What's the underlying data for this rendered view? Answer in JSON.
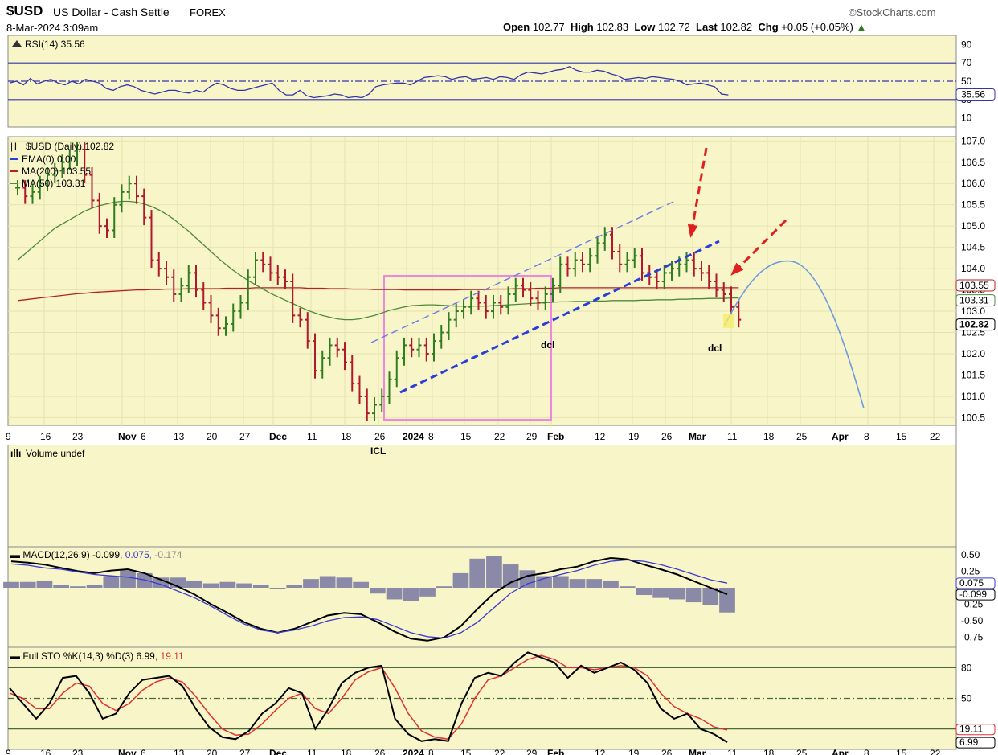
{
  "header": {
    "symbol": "$USD",
    "name": "US Dollar - Cash Settle",
    "exchange": "FOREX",
    "source": "©StockCharts.com",
    "datetime": "8-Mar-2024 3:09am",
    "open_label": "Open",
    "open": "102.77",
    "high_label": "High",
    "high": "102.83",
    "low_label": "Low",
    "low": "102.72",
    "last_label": "Last",
    "last": "102.82",
    "chg_label": "Chg",
    "chg": "+0.05 (+0.05%)"
  },
  "colors": {
    "panel_bg": "#f8f6c8",
    "price_up": "#2e7d1e",
    "price_down": "#b0182c",
    "ma200": "#b22222",
    "ma50": "#4f8a3a",
    "channel": "#2b3fd8",
    "box": "#ee88dd",
    "forecast": "#6b9be0",
    "arrow": "#e02020",
    "rsi": "#3434a8",
    "macd": "#000000",
    "signal": "#3a3ad0",
    "hist": "#8a8aa8",
    "k_line": "#000000",
    "d_line": "#e03030"
  },
  "chart_data": [
    {
      "type": "line",
      "panel": "rsi",
      "title": "RSI(14) 35.56",
      "ylim": [
        0,
        100
      ],
      "ticks": [
        "90",
        "70",
        "50",
        "30",
        "10"
      ],
      "tick_values": [
        90,
        70,
        50,
        30,
        10
      ],
      "reference_lines": [
        70,
        50,
        30
      ],
      "last_label": "35.56",
      "series": [
        {
          "name": "RSI(14)",
          "values": [
            48,
            50,
            46,
            53,
            47,
            50,
            52,
            48,
            46,
            50,
            47,
            52,
            50,
            48,
            42,
            40,
            44,
            46,
            44,
            40,
            38,
            36,
            38,
            40,
            40,
            38,
            37,
            40,
            38,
            44,
            48,
            46,
            42,
            40,
            40,
            42,
            44,
            46,
            48,
            40,
            35,
            35,
            40,
            34,
            32,
            33,
            34,
            36,
            35,
            32,
            33,
            32,
            36,
            44,
            46,
            47,
            48,
            48,
            46,
            50,
            54,
            55,
            56,
            55,
            52,
            54,
            55,
            52,
            53,
            54,
            52,
            55,
            54,
            52,
            57,
            60,
            59,
            58,
            60,
            62,
            63,
            66,
            62,
            60,
            60,
            62,
            61,
            58,
            56,
            52,
            53,
            54,
            53,
            55,
            54,
            53,
            52,
            50,
            46,
            47,
            48,
            46,
            44,
            36,
            35
          ]
        }
      ]
    },
    {
      "type": "bar",
      "panel": "price",
      "title": "$USD (Daily) 102.82",
      "ylim": [
        100.3,
        107.1
      ],
      "ticks": [
        "107.0",
        "106.5",
        "106.0",
        "105.5",
        "105.0",
        "104.5",
        "104.0",
        "103.5",
        "103.0",
        "102.5",
        "102.0",
        "101.5",
        "101.0",
        "100.5"
      ],
      "tick_values": [
        107.0,
        106.5,
        106.0,
        105.5,
        105.0,
        104.5,
        104.0,
        103.5,
        103.0,
        102.5,
        102.0,
        101.5,
        101.0,
        100.5
      ],
      "legend": [
        "EMA(0) 0.00",
        "MA(200) 103.55",
        "MA(50) 103.31"
      ],
      "right_labels": [
        "103.55",
        "103.31",
        "102.82"
      ],
      "x_labels": [
        "9",
        "16",
        "23",
        "Nov",
        "6",
        "13",
        "20",
        "27",
        "Dec",
        "11",
        "18",
        "26",
        "2024",
        "8",
        "15",
        "22",
        "29",
        "Feb",
        "12",
        "19",
        "26",
        "Mar",
        "11",
        "18",
        "25",
        "Apr",
        "8",
        "15",
        "22"
      ],
      "annotations": [
        "ICL",
        "dcl",
        "dcl"
      ],
      "ohlc_close": [
        105.9,
        105.7,
        105.8,
        106.0,
        106.2,
        106.3,
        106.5,
        106.6,
        106.8,
        106.2,
        105.6,
        105.0,
        104.9,
        105.5,
        105.8,
        106.0,
        105.7,
        105.2,
        104.2,
        104.0,
        103.8,
        103.4,
        103.6,
        103.9,
        103.5,
        103.2,
        102.9,
        102.6,
        102.7,
        103.0,
        103.2,
        103.8,
        104.2,
        104.1,
        103.9,
        103.8,
        103.7,
        102.9,
        102.8,
        102.3,
        101.6,
        101.9,
        102.2,
        102.1,
        101.8,
        101.3,
        101.0,
        100.6,
        100.8,
        101.0,
        101.4,
        101.9,
        102.2,
        102.1,
        102.2,
        102.0,
        102.3,
        102.5,
        102.8,
        103.0,
        103.1,
        103.3,
        103.2,
        103.0,
        103.2,
        103.1,
        103.4,
        103.6,
        103.5,
        103.3,
        103.2,
        103.4,
        103.6,
        104.1,
        104.0,
        104.2,
        104.1,
        104.3,
        104.6,
        104.8,
        104.4,
        104.1,
        104.2,
        104.3,
        103.9,
        103.8,
        103.7,
        103.9,
        104.0,
        104.1,
        104.2,
        104.0,
        103.9,
        103.7,
        103.5,
        103.4,
        103.1,
        102.8
      ],
      "ma200": [
        103.25,
        103.27,
        103.29,
        103.31,
        103.33,
        103.35,
        103.37,
        103.39,
        103.41,
        103.42,
        103.44,
        103.45,
        103.46,
        103.47,
        103.48,
        103.49,
        103.5,
        103.5,
        103.51,
        103.51,
        103.52,
        103.52,
        103.52,
        103.53,
        103.53,
        103.53,
        103.53,
        103.53,
        103.54,
        103.54,
        103.54,
        103.54,
        103.55,
        103.55,
        103.55,
        103.55,
        103.55,
        103.55,
        103.55,
        103.54,
        103.54,
        103.54,
        103.53,
        103.53,
        103.53,
        103.52,
        103.52,
        103.52,
        103.51,
        103.51,
        103.51,
        103.51,
        103.5,
        103.5,
        103.5,
        103.5,
        103.5,
        103.5,
        103.5,
        103.5,
        103.51,
        103.51,
        103.51,
        103.51,
        103.52,
        103.52,
        103.52,
        103.53,
        103.53,
        103.53,
        103.54,
        103.54,
        103.54,
        103.55,
        103.55,
        103.55,
        103.55,
        103.55,
        103.55,
        103.55,
        103.55,
        103.55,
        103.55,
        103.55,
        103.55,
        103.55,
        103.55,
        103.55,
        103.55,
        103.55,
        103.55,
        103.55,
        103.55,
        103.55,
        103.55,
        103.55,
        103.55,
        103.55
      ],
      "ma50": [
        104.2,
        104.35,
        104.5,
        104.65,
        104.8,
        104.95,
        105.05,
        105.15,
        105.25,
        105.35,
        105.42,
        105.48,
        105.52,
        105.56,
        105.58,
        105.58,
        105.56,
        105.52,
        105.46,
        105.38,
        105.28,
        105.16,
        105.02,
        104.88,
        104.72,
        104.56,
        104.4,
        104.24,
        104.1,
        103.96,
        103.84,
        103.72,
        103.62,
        103.52,
        103.42,
        103.34,
        103.26,
        103.18,
        103.1,
        103.02,
        102.96,
        102.9,
        102.86,
        102.82,
        102.8,
        102.8,
        102.82,
        102.86,
        102.9,
        102.96,
        103.02,
        103.06,
        103.1,
        103.13,
        103.14,
        103.15,
        103.15,
        103.14,
        103.13,
        103.12,
        103.12,
        103.12,
        103.12,
        103.12,
        103.13,
        103.14,
        103.15,
        103.16,
        103.17,
        103.18,
        103.19,
        103.2,
        103.21,
        103.22,
        103.22,
        103.23,
        103.23,
        103.23,
        103.24,
        103.24,
        103.25,
        103.25,
        103.25,
        103.25,
        103.26,
        103.26,
        103.27,
        103.27,
        103.27,
        103.28,
        103.28,
        103.29,
        103.29,
        103.3,
        103.3,
        103.3,
        103.31,
        103.31
      ]
    },
    {
      "type": "bar",
      "panel": "volume",
      "title": "Volume undef"
    },
    {
      "type": "line",
      "panel": "macd",
      "title": "MACD(12,26,9)",
      "title_values": [
        "-0.099",
        "0.075",
        "-0.174"
      ],
      "ticks": [
        "0.50",
        "0.25",
        "0.00",
        "-0.25",
        "-0.50",
        "-0.75"
      ],
      "tick_values": [
        0.5,
        0.25,
        0.0,
        -0.25,
        -0.5,
        -0.75
      ],
      "ylim": [
        -0.9,
        0.62
      ],
      "right_labels": [
        "0.075",
        "-0.099"
      ],
      "series": [
        {
          "name": "MACD",
          "values": [
            0.4,
            0.38,
            0.35,
            0.3,
            0.25,
            0.22,
            0.26,
            0.28,
            0.22,
            0.12,
            0.02,
            -0.1,
            -0.25,
            -0.38,
            -0.52,
            -0.62,
            -0.68,
            -0.62,
            -0.52,
            -0.42,
            -0.38,
            -0.4,
            -0.52,
            -0.66,
            -0.77,
            -0.8,
            -0.75,
            -0.58,
            -0.32,
            -0.08,
            0.08,
            0.18,
            0.22,
            0.28,
            0.32,
            0.4,
            0.45,
            0.43,
            0.35,
            0.28,
            0.2,
            0.1,
            0.0,
            -0.1
          ]
        },
        {
          "name": "Signal",
          "values": [
            0.36,
            0.34,
            0.3,
            0.28,
            0.24,
            0.2,
            0.18,
            0.16,
            0.12,
            0.05,
            -0.05,
            -0.15,
            -0.28,
            -0.42,
            -0.55,
            -0.64,
            -0.68,
            -0.64,
            -0.58,
            -0.5,
            -0.45,
            -0.44,
            -0.48,
            -0.58,
            -0.68,
            -0.74,
            -0.76,
            -0.68,
            -0.52,
            -0.3,
            -0.08,
            0.06,
            0.14,
            0.2,
            0.26,
            0.34,
            0.4,
            0.42,
            0.4,
            0.35,
            0.28,
            0.2,
            0.12,
            0.07
          ]
        },
        {
          "name": "Histogram",
          "values": [
            0.04,
            0.04,
            0.05,
            0.02,
            0.01,
            0.02,
            0.08,
            0.12,
            0.1,
            0.07,
            0.07,
            0.05,
            0.03,
            0.04,
            0.03,
            0.02,
            0.0,
            0.02,
            0.06,
            0.08,
            0.07,
            0.04,
            -0.04,
            -0.08,
            -0.09,
            -0.06,
            0.01,
            0.1,
            0.2,
            0.22,
            0.16,
            0.12,
            0.08,
            0.08,
            0.06,
            0.06,
            0.05,
            0.01,
            -0.05,
            -0.07,
            -0.08,
            -0.1,
            -0.12,
            -0.17
          ]
        }
      ]
    },
    {
      "type": "line",
      "panel": "stochastic",
      "title": "Full STO %K(14,3) %D(3)",
      "title_values": [
        "6.99",
        "19.11"
      ],
      "ticks": [
        "80",
        "50"
      ],
      "tick_values": [
        80,
        50
      ],
      "reference_lines": [
        80,
        50,
        20
      ],
      "ylim": [
        0,
        100
      ],
      "right_labels": [
        "19.11",
        "6.99"
      ],
      "series": [
        {
          "name": "%K",
          "values": [
            60,
            45,
            30,
            45,
            70,
            72,
            55,
            30,
            35,
            55,
            68,
            70,
            72,
            62,
            40,
            22,
            12,
            10,
            18,
            35,
            45,
            60,
            55,
            20,
            40,
            65,
            75,
            80,
            82,
            30,
            15,
            8,
            10,
            8,
            45,
            70,
            75,
            72,
            85,
            95,
            90,
            85,
            70,
            82,
            75,
            80,
            85,
            78,
            65,
            40,
            30,
            35,
            20,
            15,
            7
          ]
        },
        {
          "name": "%D",
          "values": [
            55,
            50,
            40,
            40,
            55,
            65,
            62,
            45,
            38,
            45,
            58,
            66,
            70,
            66,
            52,
            35,
            20,
            14,
            15,
            25,
            38,
            50,
            55,
            40,
            35,
            50,
            68,
            76,
            80,
            60,
            35,
            18,
            12,
            10,
            25,
            50,
            68,
            72,
            80,
            88,
            92,
            88,
            80,
            80,
            78,
            80,
            82,
            80,
            72,
            55,
            42,
            35,
            30,
            22,
            19
          ]
        }
      ]
    }
  ]
}
